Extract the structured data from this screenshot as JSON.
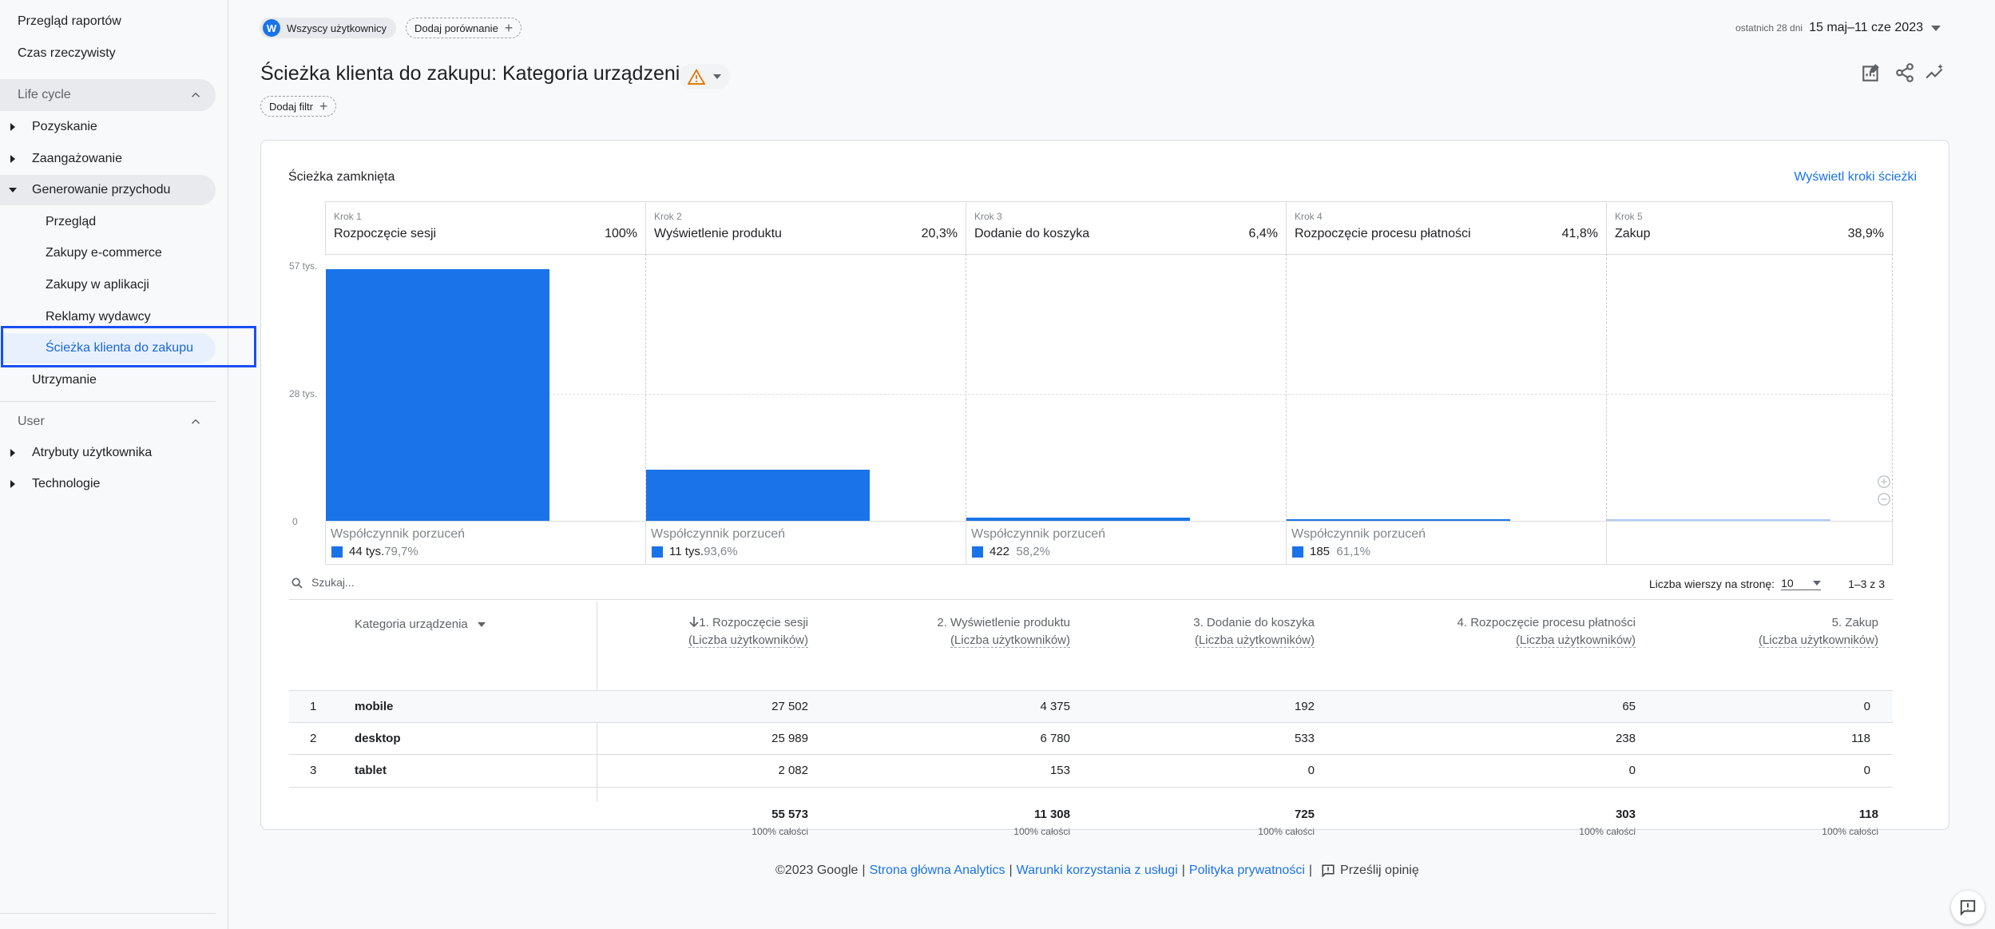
{
  "sidebar": {
    "top_items": [
      "Przegląd raportów",
      "Czas rzeczywisty"
    ],
    "sections": [
      {
        "label": "Life cycle"
      },
      {
        "label": "User"
      }
    ],
    "lifecycle_groups": [
      "Pozyskanie",
      "Zaangażowanie",
      "Generowanie przychodu",
      "Utrzymanie"
    ],
    "revenue_subitems": [
      "Przegląd",
      "Zakupy e-commerce",
      "Zakupy w aplikacji",
      "Reklamy wydawcy",
      "Ścieżka klienta do zakupu"
    ],
    "user_groups": [
      "Atrybuty użytkownika",
      "Technologie"
    ]
  },
  "topbar": {
    "segment_letter": "W",
    "segment_label": "Wszyscy użytkownicy",
    "compare_label": "Dodaj porównanie",
    "date_prefix": "ostatnich 28 dni",
    "date_range": "15 maj–11 cze 2023"
  },
  "page": {
    "title": "Ścieżka klienta do zakupu: Kategoria urządzenia",
    "add_filter": "Dodaj filtr"
  },
  "funnel": {
    "card_title": "Ścieżka zamknięta",
    "view_steps_link": "Wyświetl kroki ścieżki",
    "y_ticks": [
      "57 tys.",
      "28 tys.",
      "0"
    ],
    "steps": [
      {
        "num": "Krok 1",
        "name": "Rozpoczęcie sesji",
        "pct": "100%",
        "users": 55573,
        "drop_label": "Współczynnik porzuceń",
        "drop_count": "44 tys.",
        "drop_rate": "79,7%"
      },
      {
        "num": "Krok 2",
        "name": "Wyświetlenie produktu",
        "pct": "20,3%",
        "users": 11308,
        "drop_label": "Współczynnik porzuceń",
        "drop_count": "11 tys.",
        "drop_rate": "93,6%"
      },
      {
        "num": "Krok 3",
        "name": "Dodanie do koszyka",
        "pct": "6,4%",
        "users": 725,
        "drop_label": "Współczynnik porzuceń",
        "drop_count": "422",
        "drop_rate": "58,2%"
      },
      {
        "num": "Krok 4",
        "name": "Rozpoczęcie procesu płatności",
        "pct": "41,8%",
        "users": 303,
        "drop_label": "Współczynnik porzuceń",
        "drop_count": "185",
        "drop_rate": "61,1%"
      },
      {
        "num": "Krok 5",
        "name": "Zakup",
        "pct": "38,9%",
        "users": 118
      }
    ],
    "y_max": 57000
  },
  "table": {
    "search_placeholder": "Szukaj...",
    "rows_per_page_label": "Liczba wierszy na stronę:",
    "rows_per_page": "10",
    "pagination": "1–3 z 3",
    "dimension_header": "Kategoria urządzenia",
    "columns": [
      {
        "title": "1. Rozpoczęcie sesji",
        "sub": "(Liczba użytkowników)",
        "total": "55 573",
        "total_sub": "100% całości"
      },
      {
        "title": "2. Wyświetlenie produktu",
        "sub": "(Liczba użytkowników)",
        "total": "11 308",
        "total_sub": "100% całości"
      },
      {
        "title": "3. Dodanie do koszyka",
        "sub": "(Liczba użytkowników)",
        "total": "725",
        "total_sub": "100% całości"
      },
      {
        "title": "4. Rozpoczęcie procesu płatności",
        "sub": "(Liczba użytkowników)",
        "total": "303",
        "total_sub": "100% całości"
      },
      {
        "title": "5. Zakup",
        "sub": "(Liczba użytkowników)",
        "total": "118",
        "total_sub": "100% całości"
      }
    ],
    "rows": [
      {
        "idx": "1",
        "dim": "mobile",
        "values": [
          "27 502",
          "4 375",
          "192",
          "65",
          "0"
        ]
      },
      {
        "idx": "2",
        "dim": "desktop",
        "values": [
          "25 989",
          "6 780",
          "533",
          "238",
          "118"
        ]
      },
      {
        "idx": "3",
        "dim": "tablet",
        "values": [
          "2 082",
          "153",
          "0",
          "0",
          "0"
        ]
      }
    ]
  },
  "footer": {
    "copyright": "©2023 Google",
    "links": [
      "Strona główna Analytics",
      "Warunki korzystania z usługi",
      "Polityka prywatności"
    ],
    "feedback": "Prześlij opinię"
  },
  "colors": {
    "accent": "#1a73e8",
    "highlight": "#1a4ff5",
    "warning": "#e37400"
  }
}
